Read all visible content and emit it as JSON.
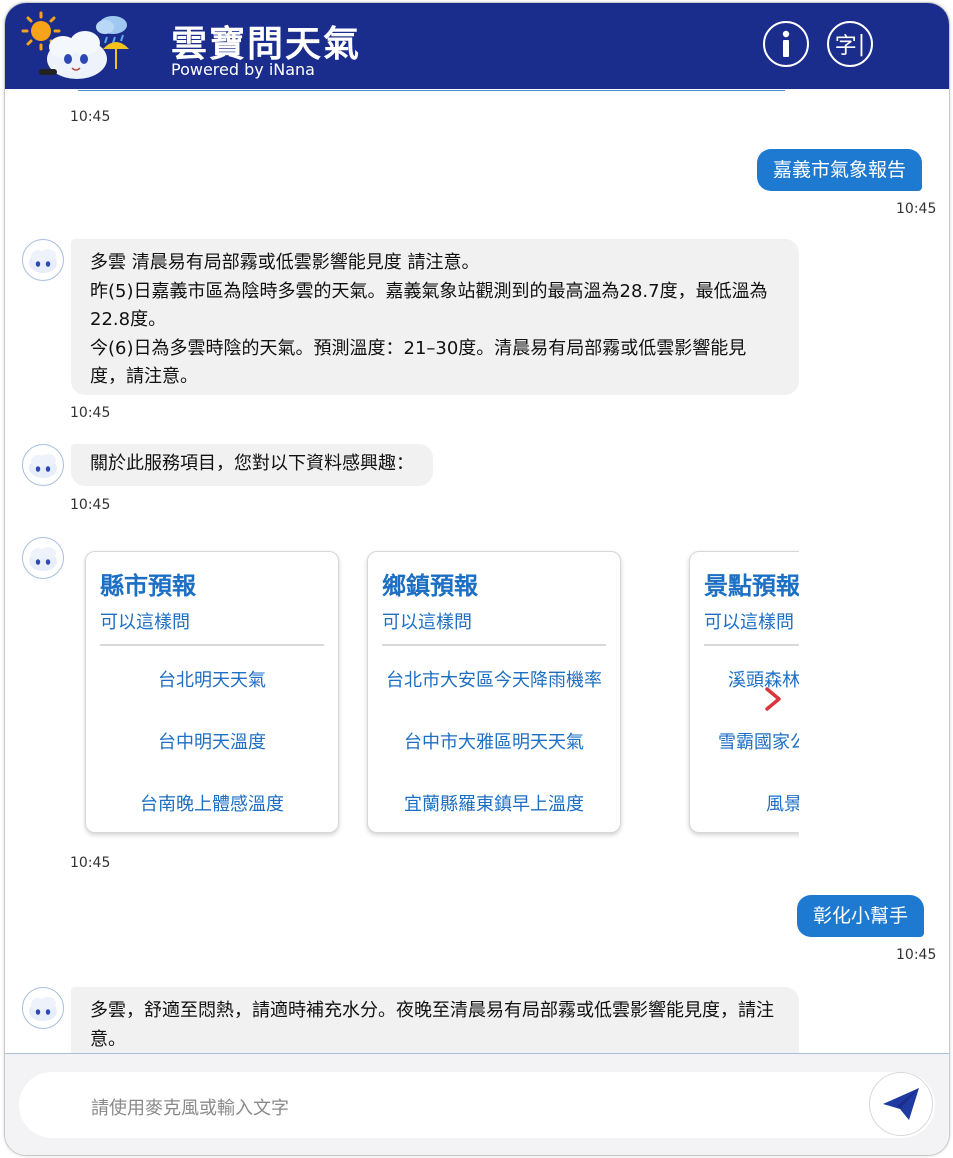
{
  "header": {
    "title": "雲寶問天氣",
    "subtitle": "Powered by iNana",
    "info_icon": "info-icon",
    "font_size_icon": "font-size-icon",
    "font_label": "字"
  },
  "messages": {
    "m1_time": "10:45",
    "m2_text": "嘉義市氣象報告",
    "m2_time": "10:45",
    "m3_lines": [
      "多雲 清晨易有局部霧或低雲影響能見度 請注意。",
      "昨(5)日嘉義市區為陰時多雲的天氣。嘉義氣象站觀測到的最高溫為28.7度，最低溫為22.8度。",
      "今(6)日為多雲時陰的天氣。預測溫度：21–30度。清晨易有局部霧或低雲影響能見度，請注意。"
    ],
    "m3_time": "10:45",
    "m4_text": "關於此服務項目，您對以下資料感興趣：",
    "m4_time": "10:45",
    "m5_time": "10:45",
    "m6_text": "彰化小幫手",
    "m6_time": "10:45",
    "m7_text": "多雲，舒適至悶熱，請適時補充水分。夜晚至清晨易有局部霧或低雲影響能見度，請注意。"
  },
  "cards": [
    {
      "title": "縣市預報",
      "subtitle": "可以這樣問",
      "items": [
        "台北明天天氣",
        "台中明天溫度",
        "台南晚上體感溫度"
      ]
    },
    {
      "title": "鄉鎮預報",
      "subtitle": "可以這樣問",
      "items": [
        "台北市大安區今天降雨機率",
        "台中市大雅區明天天氣",
        "宜蘭縣羅東鎮早上溫度"
      ]
    },
    {
      "title": "景點預報",
      "subtitle": "可以這樣問",
      "items": [
        "溪頭森林",
        "雪霸國家公",
        "風景"
      ]
    }
  ],
  "composer": {
    "placeholder": "請使用麥克風或輸入文字",
    "send_icon": "send-icon"
  },
  "colors": {
    "header_bg": "#1a2d8c",
    "user_bubble": "#1d7ad0",
    "bot_bubble": "#f1f1f2",
    "card_text": "#1d6fc4",
    "next_arrow": "#d9363e"
  }
}
